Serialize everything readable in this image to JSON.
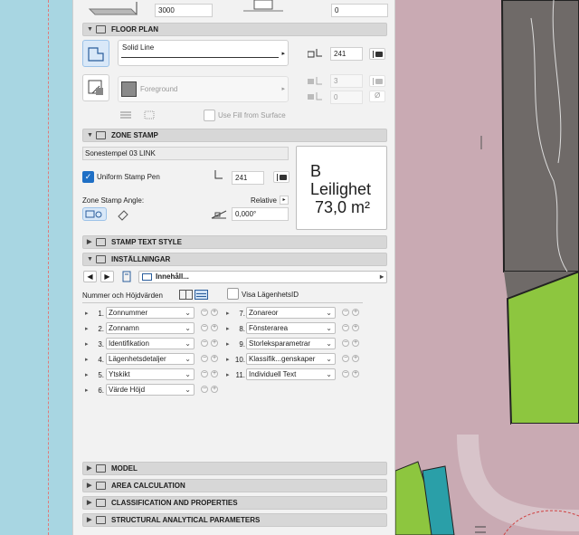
{
  "top": {
    "elevation_value": "3000",
    "offset_value": "0"
  },
  "floor_plan": {
    "header": "FLOOR PLAN",
    "line_type": "Solid Line",
    "pen_value": "241",
    "fill_type": "Foreground",
    "fill_pen": "3",
    "bg_pen": "0",
    "use_fill_label": "Use Fill from Surface"
  },
  "zone_stamp": {
    "header": "ZONE STAMP",
    "stamp_name": "Sonestempel 03 LINK",
    "uniform_pen_label": "Uniform Stamp Pen",
    "uniform_pen_checked": true,
    "pen_value": "241",
    "angle_label": "Zone Stamp Angle:",
    "relative_label": "Relative",
    "angle_value": "0,000°",
    "preview": {
      "line1": "B",
      "line2": "Leilighet",
      "line3": "73,0 m²"
    }
  },
  "stamp_text_style": {
    "header": "STAMP TEXT STYLE"
  },
  "installningar": {
    "header": "INSTÄLLNINGAR",
    "content_selector": "Innehåll...",
    "mode_label": "Nummer och Höjdvärden",
    "visa_label": "Visa LägenhetsID",
    "left_rows": [
      {
        "num": "1.",
        "value": "Zonnummer"
      },
      {
        "num": "2.",
        "value": "Zonnamn"
      },
      {
        "num": "3.",
        "value": "Identifikation"
      },
      {
        "num": "4.",
        "value": "Lägenhetsdetaljer"
      },
      {
        "num": "5.",
        "value": "Ytskikt"
      },
      {
        "num": "6.",
        "value": "Värde Höjd"
      }
    ],
    "right_rows": [
      {
        "num": "7.",
        "value": "Zonareor"
      },
      {
        "num": "8.",
        "value": "Fönsterarea"
      },
      {
        "num": "9.",
        "value": "Storleksparametrar"
      },
      {
        "num": "10.",
        "value": "Klassifik...genskaper"
      },
      {
        "num": "11.",
        "value": "Individuell Text"
      }
    ]
  },
  "bottom_sections": [
    {
      "header": "MODEL"
    },
    {
      "header": "AREA CALCULATION"
    },
    {
      "header": "CLASSIFICATION AND PROPERTIES"
    },
    {
      "header": "STRUCTURAL ANALYTICAL PARAMETERS"
    }
  ],
  "colors": {
    "panel": "#f2f2f2",
    "section": "#d7d7d7",
    "accent": "#1f6fc5",
    "plan_green": "#8dc63f",
    "plan_pink": "#c9aab3",
    "plan_grey": "#6f6a68"
  }
}
